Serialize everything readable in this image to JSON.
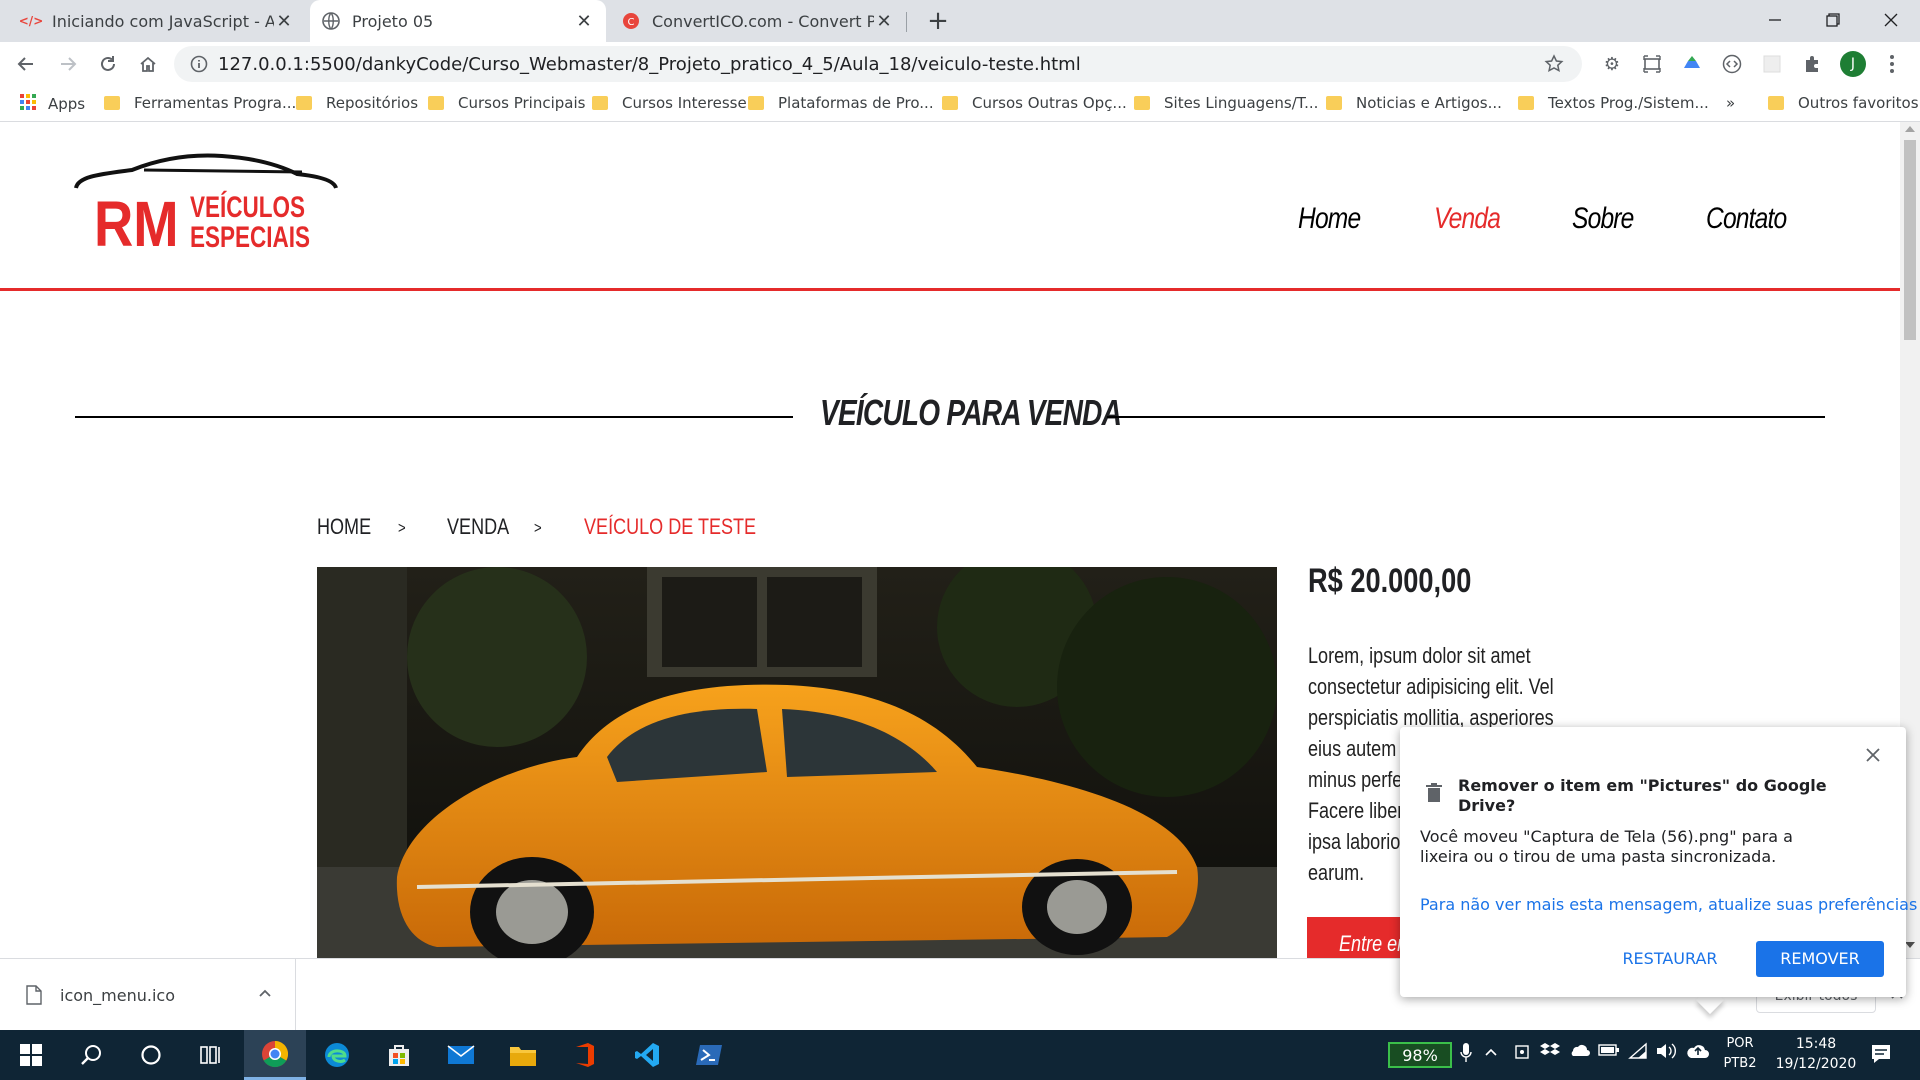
{
  "browser": {
    "tabs": [
      {
        "title": "Iniciando com JavaScript - Apres",
        "favicon": "code-icon",
        "active": false
      },
      {
        "title": "Projeto 05",
        "favicon": "globe-icon",
        "active": true
      },
      {
        "title": "ConvertICO.com - Convert PNG t",
        "favicon": "converter-icon",
        "active": false
      }
    ],
    "new_tab_glyph": "+",
    "close_glyph": "✕",
    "url": "127.0.0.1:5500/dankyCode/Curso_Webmaster/8_Projeto_pratico_4_5/Aula_18/veiculo-teste.html",
    "profile_initial": "J",
    "bookmarks": [
      "Apps",
      "Ferramentas Progra...",
      "Repositórios",
      "Cursos Principais",
      "Cursos Interesse",
      "Plataformas de Pro...",
      "Cursos Outras Opç...",
      "Sites Linguagens/T...",
      "Noticias e Artigos...",
      "Textos Prog./Sistem..."
    ],
    "bookmarks_overflow": "»",
    "other_bookmarks": "Outros favoritos"
  },
  "site": {
    "logo": {
      "line1": "RM",
      "line2a": "VEÍCULOS",
      "line2b": "ESPECIAIS"
    },
    "nav": [
      "Home",
      "Venda",
      "Sobre",
      "Contato"
    ],
    "section_title": "VEÍCULO PARA VENDA",
    "breadcrumb": [
      {
        "label": "HOME",
        "active": false
      },
      {
        "label": "VENDA",
        "active": false
      },
      {
        "label": "VEÍCULO DE TESTE",
        "active": true
      }
    ],
    "breadcrumb_separator": ">",
    "price": "R$ 20.000,00",
    "description_lines": [
      "Lorem, ipsum dolor sit amet",
      "consectetur adipisicing elit. Vel",
      "perspiciatis mollitia, asperiores",
      "eius autem e",
      "minus perfe",
      "Facere liber",
      "ipsa laborios",
      "earum."
    ],
    "contact_button": "Entre em",
    "accent_color": "#e52b2b"
  },
  "notification": {
    "title": "Remover o item em \"Pictures\" do Google Drive?",
    "body": "Você moveu \"Captura de Tela (56).png\" para a lixeira ou o tirou de uma pasta sincronizada.",
    "link": "Para não ver mais esta mensagem, atualize suas preferências",
    "restore": "RESTAURAR",
    "remove": "REMOVER",
    "close_glyph": "✕"
  },
  "downloads": {
    "file": "icon_menu.ico",
    "show_all": "Exibir todos"
  },
  "taskbar": {
    "battery": "98%",
    "lang_top": "POR",
    "lang_bottom": "PTB2",
    "time": "15:48",
    "date": "19/12/2020"
  }
}
